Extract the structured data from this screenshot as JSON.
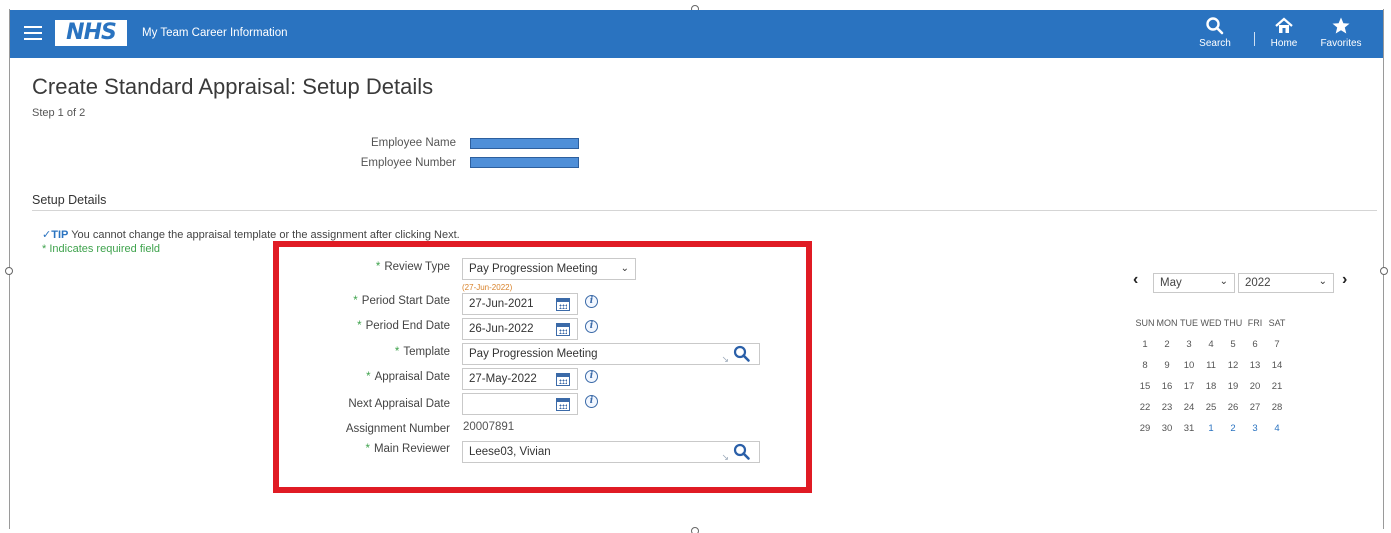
{
  "header": {
    "app_title": "My Team Career Information",
    "logo_text": "NHS",
    "nav": [
      {
        "label": "Search",
        "icon": "search-icon"
      },
      {
        "label": "Home",
        "icon": "home-icon"
      },
      {
        "label": "Favorites",
        "icon": "star-icon"
      }
    ]
  },
  "page": {
    "title": "Create Standard Appraisal: Setup Details",
    "step": "Step 1 of 2"
  },
  "employee": {
    "name_label": "Employee Name",
    "number_label": "Employee Number"
  },
  "section": {
    "title": "Setup Details",
    "tip_prefix": "TIP",
    "tip_text": " You cannot change the appraisal template or the assignment after clicking Next.",
    "required_note": "* Indicates required field"
  },
  "form": {
    "review_type": {
      "label": "Review Type",
      "value": "Pay Progression Meeting",
      "hint": "(27-Jun-2022)"
    },
    "period_start": {
      "label": "Period Start Date",
      "value": "27-Jun-2021"
    },
    "period_end": {
      "label": "Period End Date",
      "value": "26-Jun-2022"
    },
    "template": {
      "label": "Template",
      "value": "Pay Progression Meeting"
    },
    "appraisal_date": {
      "label": "Appraisal Date",
      "value": "27-May-2022"
    },
    "next_appraisal_date": {
      "label": "Next Appraisal Date",
      "value": ""
    },
    "assignment_number": {
      "label": "Assignment Number",
      "value": "20007891"
    },
    "main_reviewer": {
      "label": "Main Reviewer",
      "value": "Leese03, Vivian"
    }
  },
  "calendar": {
    "month": "May",
    "year": "2022",
    "weekdays": [
      "SUN",
      "MON",
      "TUE",
      "WED",
      "THU",
      "FRI",
      "SAT"
    ],
    "weeks": [
      [
        "1",
        "2",
        "3",
        "4",
        "5",
        "6",
        "7"
      ],
      [
        "8",
        "9",
        "10",
        "11",
        "12",
        "13",
        "14"
      ],
      [
        "15",
        "16",
        "17",
        "18",
        "19",
        "20",
        "21"
      ],
      [
        "22",
        "23",
        "24",
        "25",
        "26",
        "27",
        "28"
      ],
      [
        "29",
        "30",
        "31",
        "1",
        "2",
        "3",
        "4"
      ]
    ],
    "other_month_from_index_in_last_week": 3
  },
  "colors": {
    "header_bg": "#2a73c0",
    "highlight_border": "#e01b24",
    "required_green": "#3fa34d",
    "redaction": "#4f8fd8"
  }
}
